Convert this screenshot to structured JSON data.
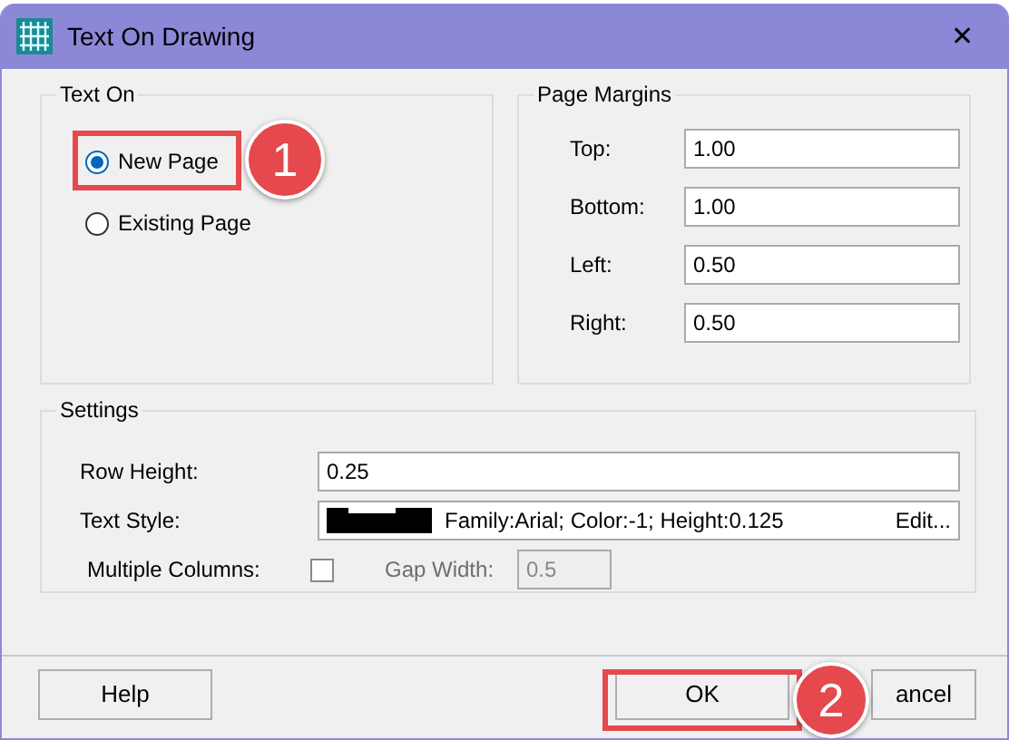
{
  "window": {
    "title": "Text On Drawing",
    "close": "✕"
  },
  "text_on": {
    "title": "Text On",
    "options": [
      {
        "label": "New Page",
        "selected": true
      },
      {
        "label": "Existing Page",
        "selected": false
      }
    ]
  },
  "page_margins": {
    "title": "Page Margins",
    "fields": [
      {
        "label": "Top:",
        "value": "1.00"
      },
      {
        "label": "Bottom:",
        "value": "1.00"
      },
      {
        "label": "Left:",
        "value": "0.50"
      },
      {
        "label": "Right:",
        "value": "0.50"
      }
    ]
  },
  "settings": {
    "title": "Settings",
    "row_height": {
      "label": "Row Height:",
      "value": "0.25"
    },
    "text_style": {
      "label": "Text Style:",
      "description": "Family:Arial; Color:-1; Height:0.125",
      "edit": "Edit..."
    },
    "multiple_columns": {
      "label": "Multiple Columns:",
      "checked": false
    },
    "gap_width": {
      "label": "Gap Width:",
      "value": "0.5",
      "disabled": true
    }
  },
  "buttons": [
    {
      "label": "Help"
    },
    {
      "label": "OK"
    },
    {
      "label": "ancel"
    }
  ],
  "annotations": [
    {
      "number": "1"
    },
    {
      "number": "2"
    }
  ]
}
